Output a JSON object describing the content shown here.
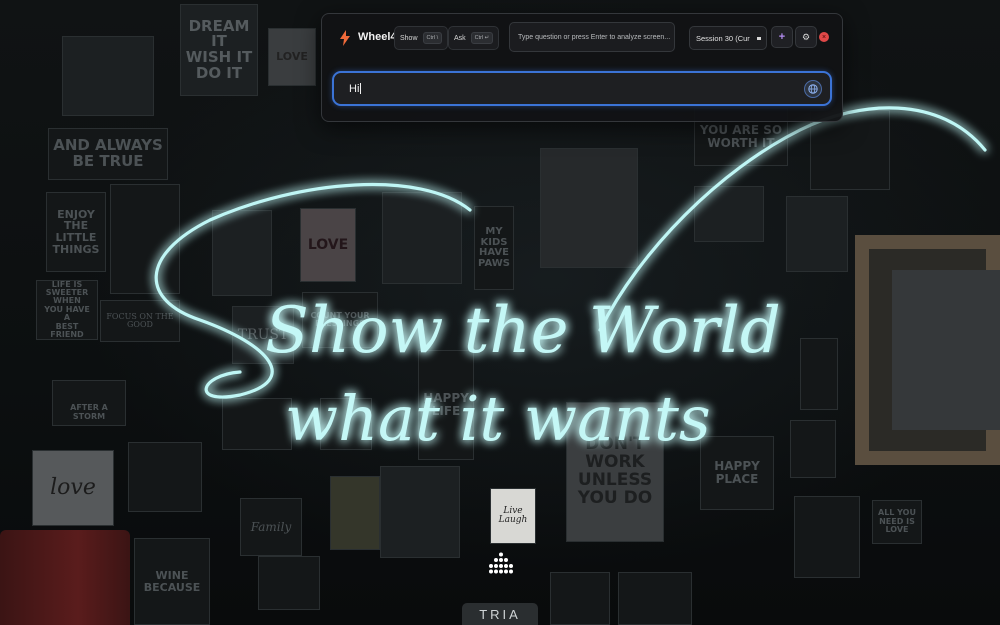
{
  "toolbar": {
    "app_name": "Wheel4",
    "show_label": "Show",
    "show_shortcut": "Ctrl \\",
    "ask_label": "Ask",
    "ask_shortcut": "Ctrl ↵",
    "question_placeholder": "Type question or press Enter to analyze screen...",
    "session_label": "Session 30 (Cur",
    "accent_color": "#3b73d6",
    "close_color": "#e04848"
  },
  "chat": {
    "input_value": "Hi"
  },
  "wallpaper": {
    "neon_line_1": "Show the World",
    "neon_line_2": "what it wants",
    "neon_color": "#7fe4e6",
    "tiles": {
      "t1": "DREAM IT\nWISH IT\nDO IT",
      "t2": "LOVE",
      "t3": "AND ALWAYS\nBE TRUE",
      "t4": "ENJOY THE\nLITTLE\nTHINGS",
      "t5": "LIFE IS\nSWEETER WHEN\nYOU HAVE A\nBEST FRIEND",
      "t6": "FOCUS ON THE\nGOOD",
      "t7": "AFTER A STORM",
      "t8": "love",
      "t9": "WINE\nBECAUSE",
      "t10": "Family",
      "t11": "COUNT YOUR\nBLESSINGS",
      "t12": "MY\nKIDS\nHAVE\nPAWS",
      "t13": "YOU ARE SO\nWORTH IT",
      "t14": "DON'T\nWORK\nUNLESS\nYOU DO",
      "t15": "HAPPY\nPLACE",
      "t16": "ALL YOU\nNEED IS\nLOVE",
      "t17": "LOVE",
      "t18": "HAPPY\nLIFE",
      "t19": "Live Laugh",
      "t20": "TRUST"
    }
  },
  "dock": {
    "label": "TRIA"
  }
}
